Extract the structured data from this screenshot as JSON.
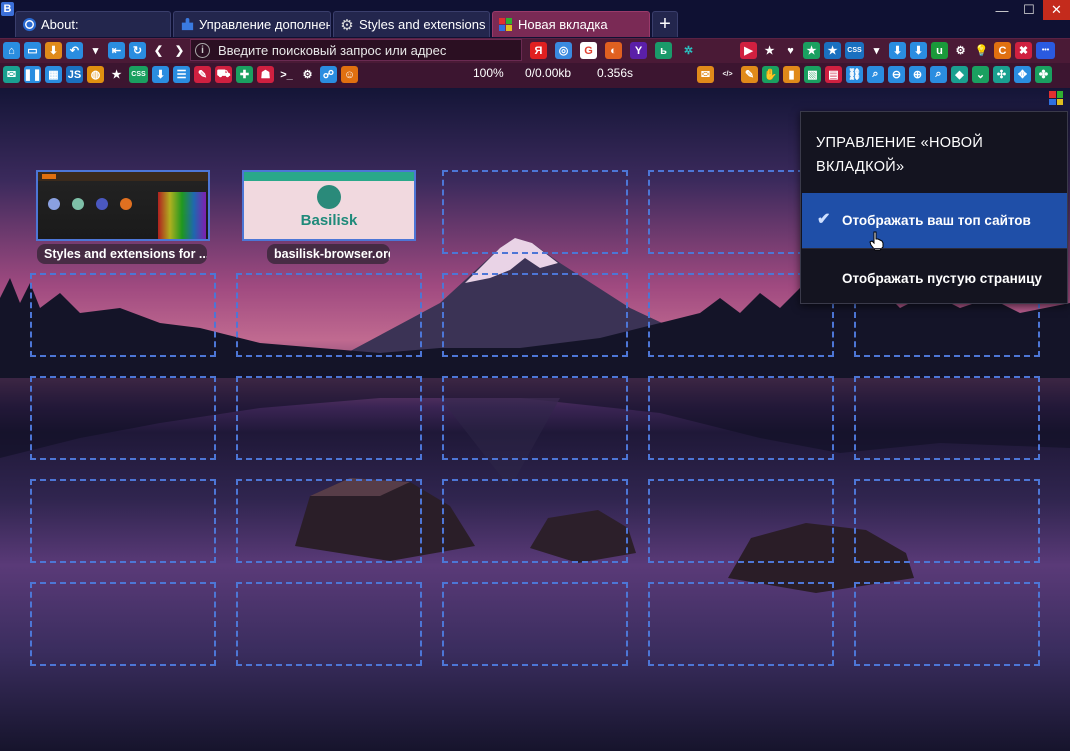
{
  "app": {
    "badge": "B"
  },
  "tabs": [
    {
      "label": "About:",
      "icon": "globe-icon",
      "width": 156
    },
    {
      "label": "Управление дополнениями",
      "icon": "puzzle-icon",
      "width": 158
    },
    {
      "label": "Styles and extensions for",
      "icon": "gear-icon",
      "width": 157
    },
    {
      "label": "Новая вкладка",
      "icon": "tile-icon",
      "width": 158,
      "active": true
    }
  ],
  "new_tab_label": "+",
  "window_controls": {
    "minimize": "—",
    "maximize": "☐",
    "close": "✕"
  },
  "address": {
    "placeholder": "Введите поисковый запрос или адрес",
    "info": "i"
  },
  "status": {
    "zoom": "100%",
    "traffic": "0/0.00kb",
    "time": "0.356s"
  },
  "toolbar1_icons": [
    {
      "name": "home-icon",
      "glyph": "⌂",
      "color": "#2a8de0"
    },
    {
      "name": "drive-icon",
      "glyph": "▭",
      "color": "#2a8de0"
    },
    {
      "name": "download-icon",
      "glyph": "⬇",
      "color": "#e08a1a"
    },
    {
      "name": "undo-icon",
      "glyph": "↶",
      "color": "#2a8de0"
    },
    {
      "name": "dropdown-icon",
      "glyph": "▾",
      "color": "transparent"
    },
    {
      "name": "first-icon",
      "glyph": "⇤",
      "color": "#2a8de0"
    },
    {
      "name": "reload-icon",
      "glyph": "↻",
      "color": "#2a8de0"
    },
    {
      "name": "back-icon",
      "glyph": "❮",
      "color": "transparent"
    },
    {
      "name": "forward-icon",
      "glyph": "❯",
      "color": "transparent"
    }
  ],
  "search_icons": [
    {
      "name": "yandex-icon",
      "glyph": "Я",
      "color": "#e02020"
    },
    {
      "name": "web-icon",
      "glyph": "◎",
      "color": "#3a8ae0"
    },
    {
      "name": "google-icon",
      "glyph": "G",
      "color": "#ffffff",
      "fg": "#e04030"
    },
    {
      "name": "duckduckgo-icon",
      "glyph": "◐",
      "color": "#e06020"
    },
    {
      "name": "yahoo-icon",
      "glyph": "Y",
      "color": "#5b1fa8"
    },
    {
      "name": "bing-icon",
      "glyph": "ь",
      "color": "#1a9a6a"
    },
    {
      "name": "tools-icon",
      "glyph": "✲",
      "color": "transparent",
      "fg": "#2ac0c0"
    }
  ],
  "toolbar1_right_icons": [
    {
      "name": "youtube-icon",
      "glyph": "▶",
      "color": "#d02040"
    },
    {
      "name": "star-icon",
      "glyph": "★",
      "color": "transparent"
    },
    {
      "name": "heart-icon",
      "glyph": "♥",
      "color": "transparent"
    },
    {
      "name": "star-green-icon",
      "glyph": "★",
      "color": "#1aa060"
    },
    {
      "name": "star-blue-icon",
      "glyph": "★",
      "color": "#1a70c0"
    },
    {
      "name": "css-icon",
      "glyph": "CSS",
      "color": "#1a70c0"
    },
    {
      "name": "dropdown2-icon",
      "glyph": "▾",
      "color": "transparent"
    },
    {
      "name": "save-icon",
      "glyph": "⬇",
      "color": "#2a8de0"
    },
    {
      "name": "save2-icon",
      "glyph": "⬇",
      "color": "#2a8de0"
    },
    {
      "name": "ublock-icon",
      "glyph": "u",
      "color": "#1a9a3a"
    },
    {
      "name": "settings-icon",
      "glyph": "⚙",
      "color": "transparent"
    },
    {
      "name": "bulb-icon",
      "glyph": "💡",
      "color": "transparent"
    },
    {
      "name": "refresh-orange-icon",
      "glyph": "C",
      "color": "#e07010"
    },
    {
      "name": "wrench-icon",
      "glyph": "✖",
      "color": "#d02040"
    },
    {
      "name": "more-icon",
      "glyph": "•••",
      "color": "#2a5ae0"
    }
  ],
  "toolbar2_icons": [
    {
      "name": "mail-icon",
      "glyph": "✉",
      "color": "#1aa090"
    },
    {
      "name": "pause-icon",
      "glyph": "❚❚",
      "color": "#2a8de0"
    },
    {
      "name": "image-icon",
      "glyph": "▦",
      "color": "#2a8de0"
    },
    {
      "name": "js-icon",
      "glyph": "JS",
      "color": "#1a70c0"
    },
    {
      "name": "ring-icon",
      "glyph": "◍",
      "color": "#e09010"
    },
    {
      "name": "star2-icon",
      "glyph": "★",
      "color": "transparent"
    },
    {
      "name": "css2-icon",
      "glyph": "CSS",
      "color": "#1aa060"
    },
    {
      "name": "down-arrow-icon",
      "glyph": "⬇",
      "color": "#2a8de0"
    },
    {
      "name": "list-icon",
      "glyph": "☰",
      "color": "#2a8de0"
    },
    {
      "name": "pencil-icon",
      "glyph": "✎",
      "color": "#d02040"
    },
    {
      "name": "car-icon",
      "glyph": "⛟",
      "color": "#d02040"
    },
    {
      "name": "game-icon",
      "glyph": "✚",
      "color": "#1aa060"
    },
    {
      "name": "robot-icon",
      "glyph": "☗",
      "color": "#d02040"
    },
    {
      "name": "terminal-icon",
      "glyph": ">_",
      "color": "transparent"
    },
    {
      "name": "gear2-icon",
      "glyph": "⚙",
      "color": "transparent"
    },
    {
      "name": "network-icon",
      "glyph": "☍",
      "color": "#2a8de0"
    },
    {
      "name": "user-icon",
      "glyph": "☺",
      "color": "#e07010"
    }
  ],
  "toolbar2_right_icons": [
    {
      "name": "envelope-icon",
      "glyph": "✉",
      "color": "#e08a1a"
    },
    {
      "name": "code-icon",
      "glyph": "</>",
      "color": "transparent"
    },
    {
      "name": "edit-icon",
      "glyph": "✎",
      "color": "#e08a1a"
    },
    {
      "name": "paint-icon",
      "glyph": "✋",
      "color": "#1aa060"
    },
    {
      "name": "bookmark-icon",
      "glyph": "▮",
      "color": "#e08a1a"
    },
    {
      "name": "chart-icon",
      "glyph": "▧",
      "color": "#1aa060"
    },
    {
      "name": "calendar-icon",
      "glyph": "▤",
      "color": "#d02040"
    },
    {
      "name": "link-icon",
      "glyph": "⛓",
      "color": "#2a8de0"
    },
    {
      "name": "search-icon",
      "glyph": "⌕",
      "color": "#2a8de0"
    },
    {
      "name": "zoom-out-icon",
      "glyph": "⊖",
      "color": "#2a8de0"
    },
    {
      "name": "zoom-in-icon",
      "glyph": "⊕",
      "color": "#2a8de0"
    },
    {
      "name": "zoom-icon",
      "glyph": "⌕",
      "color": "#2a8de0"
    },
    {
      "name": "shape-icon",
      "glyph": "◆",
      "color": "#1aa090"
    },
    {
      "name": "chevron-icon",
      "glyph": "⌄",
      "color": "#1aa060"
    },
    {
      "name": "expand-icon",
      "glyph": "✣",
      "color": "#1aa090"
    },
    {
      "name": "collapse-icon",
      "glyph": "✥",
      "color": "#2a8de0"
    },
    {
      "name": "puzzle2-icon",
      "glyph": "✤",
      "color": "#1aa060"
    }
  ],
  "speed_dial": {
    "thumbs": [
      {
        "caption": "Styles and extensions for ..."
      },
      {
        "caption": "basilisk-browser.org",
        "site_name": "Basilisk"
      }
    ]
  },
  "menu": {
    "title": "УПРАВЛЕНИЕ «НОВОЙ ВКЛАДКОЙ»",
    "items": [
      {
        "label": "Отображать ваш топ сайтов",
        "checked": true
      },
      {
        "label": "Отображать пустую страницу",
        "checked": false
      }
    ]
  },
  "colors": {
    "accent": "#1f4fa8",
    "dial_border": "#4d76d6",
    "toolbar": "#4a1a36",
    "titlebar": "#0f1133"
  }
}
